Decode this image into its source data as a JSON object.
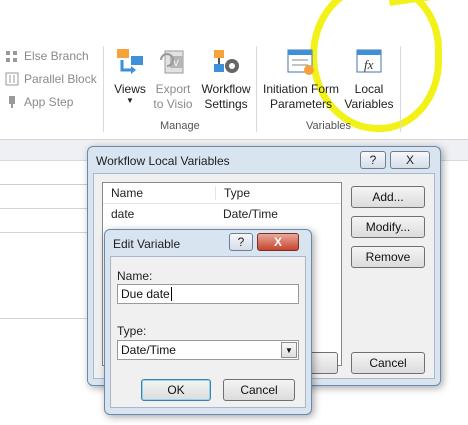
{
  "ribbon": {
    "left_items": [
      {
        "label": "Else Branch",
        "icon": "else-branch-icon"
      },
      {
        "label": "Parallel Block",
        "icon": "parallel-block-icon"
      },
      {
        "label": "App Step",
        "icon": "app-step-icon"
      }
    ],
    "buttons": {
      "views": "Views",
      "export_l1": "Export",
      "export_l2": "to Visio",
      "workflow_l1": "Workflow",
      "workflow_l2": "Settings",
      "init_l1": "Initiation Form",
      "init_l2": "Parameters",
      "local_l1": "Local",
      "local_l2": "Variables"
    },
    "groups": {
      "manage": "Manage",
      "variables": "Variables"
    },
    "highlight_color": "#f2f218"
  },
  "local_vars_dialog": {
    "title": "Workflow Local Variables",
    "help": "?",
    "close": "X",
    "columns": {
      "name": "Name",
      "type": "Type"
    },
    "rows": [
      {
        "name": "date",
        "type": "Date/Time"
      }
    ],
    "add": "Add...",
    "modify": "Modify...",
    "remove": "Remove",
    "cancel": "Cancel"
  },
  "edit_dialog": {
    "title": "Edit Variable",
    "help": "?",
    "close": "X",
    "name_label": "Name:",
    "name_value": "Due date",
    "type_label": "Type:",
    "type_value": "Date/Time",
    "ok": "OK",
    "cancel": "Cancel"
  }
}
